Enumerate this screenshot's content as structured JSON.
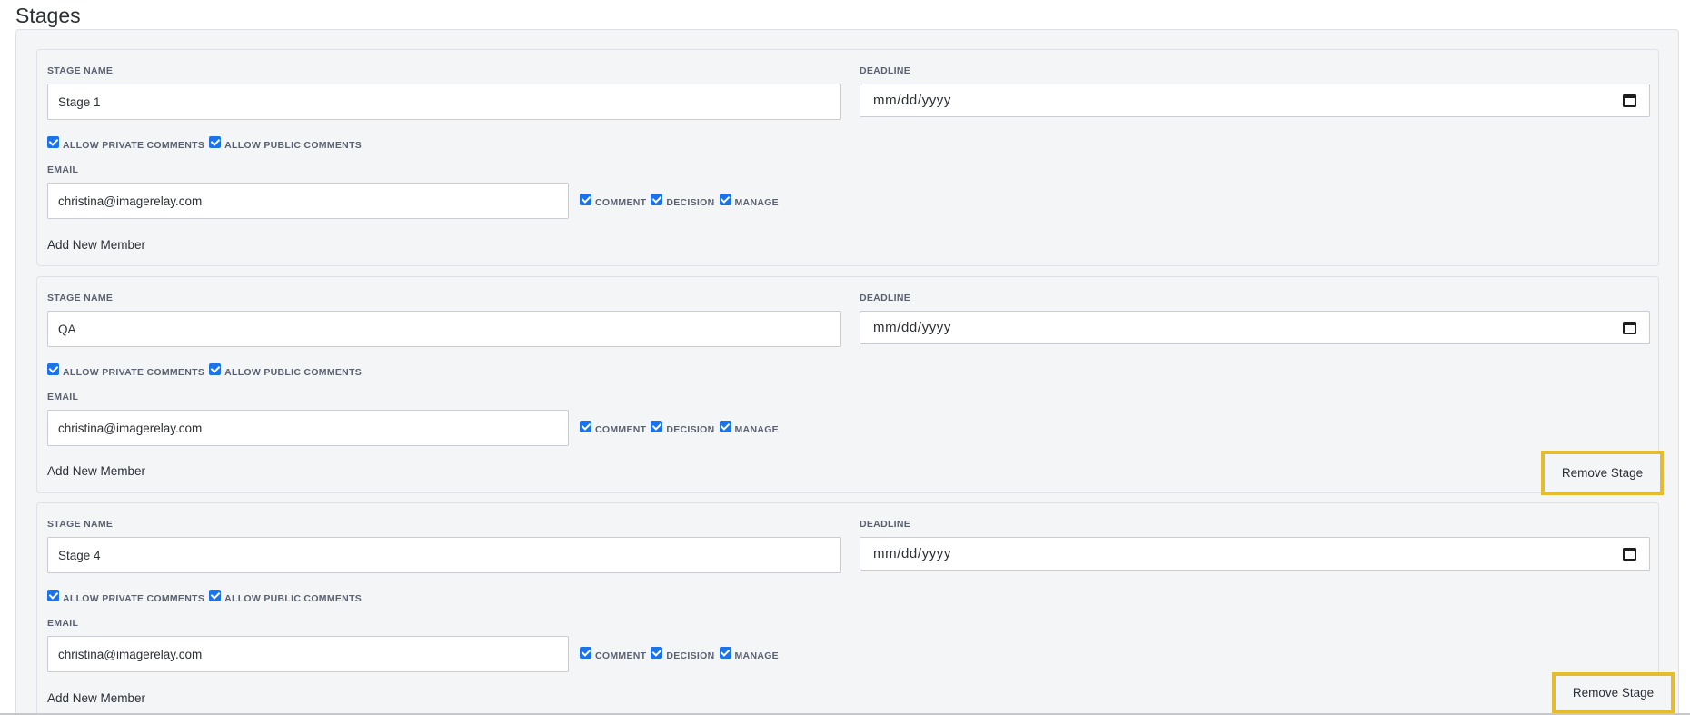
{
  "page": {
    "title": "Stages"
  },
  "labels": {
    "stage_name": "STAGE NAME",
    "deadline": "DEADLINE",
    "allow_private": "ALLOW PRIVATE COMMENTS",
    "allow_public": "ALLOW PUBLIC COMMENTS",
    "email": "EMAIL",
    "comment": "COMMENT",
    "decision": "DECISION",
    "manage": "MANAGE",
    "add_member": "Add New Member",
    "remove_stage": "Remove Stage"
  },
  "stages": [
    {
      "name": "Stage 1",
      "deadline": "mm/dd/yyyy",
      "allow_private": true,
      "allow_public": true,
      "members": [
        {
          "email": "christina@imagerelay.com",
          "comment": true,
          "decision": true,
          "manage": true
        }
      ],
      "removable": false
    },
    {
      "name": "QA",
      "deadline": "mm/dd/yyyy",
      "allow_private": true,
      "allow_public": true,
      "members": [
        {
          "email": "christina@imagerelay.com",
          "comment": true,
          "decision": true,
          "manage": true
        }
      ],
      "removable": true
    },
    {
      "name": "Stage 4",
      "deadline": "mm/dd/yyyy",
      "allow_private": true,
      "allow_public": true,
      "members": [
        {
          "email": "christina@imagerelay.com",
          "comment": true,
          "decision": true,
          "manage": true
        }
      ],
      "removable": true
    }
  ],
  "colors": {
    "highlight": "#e6bc2f",
    "checkbox": "#1a73e8",
    "panel": "#f4f5f7"
  }
}
